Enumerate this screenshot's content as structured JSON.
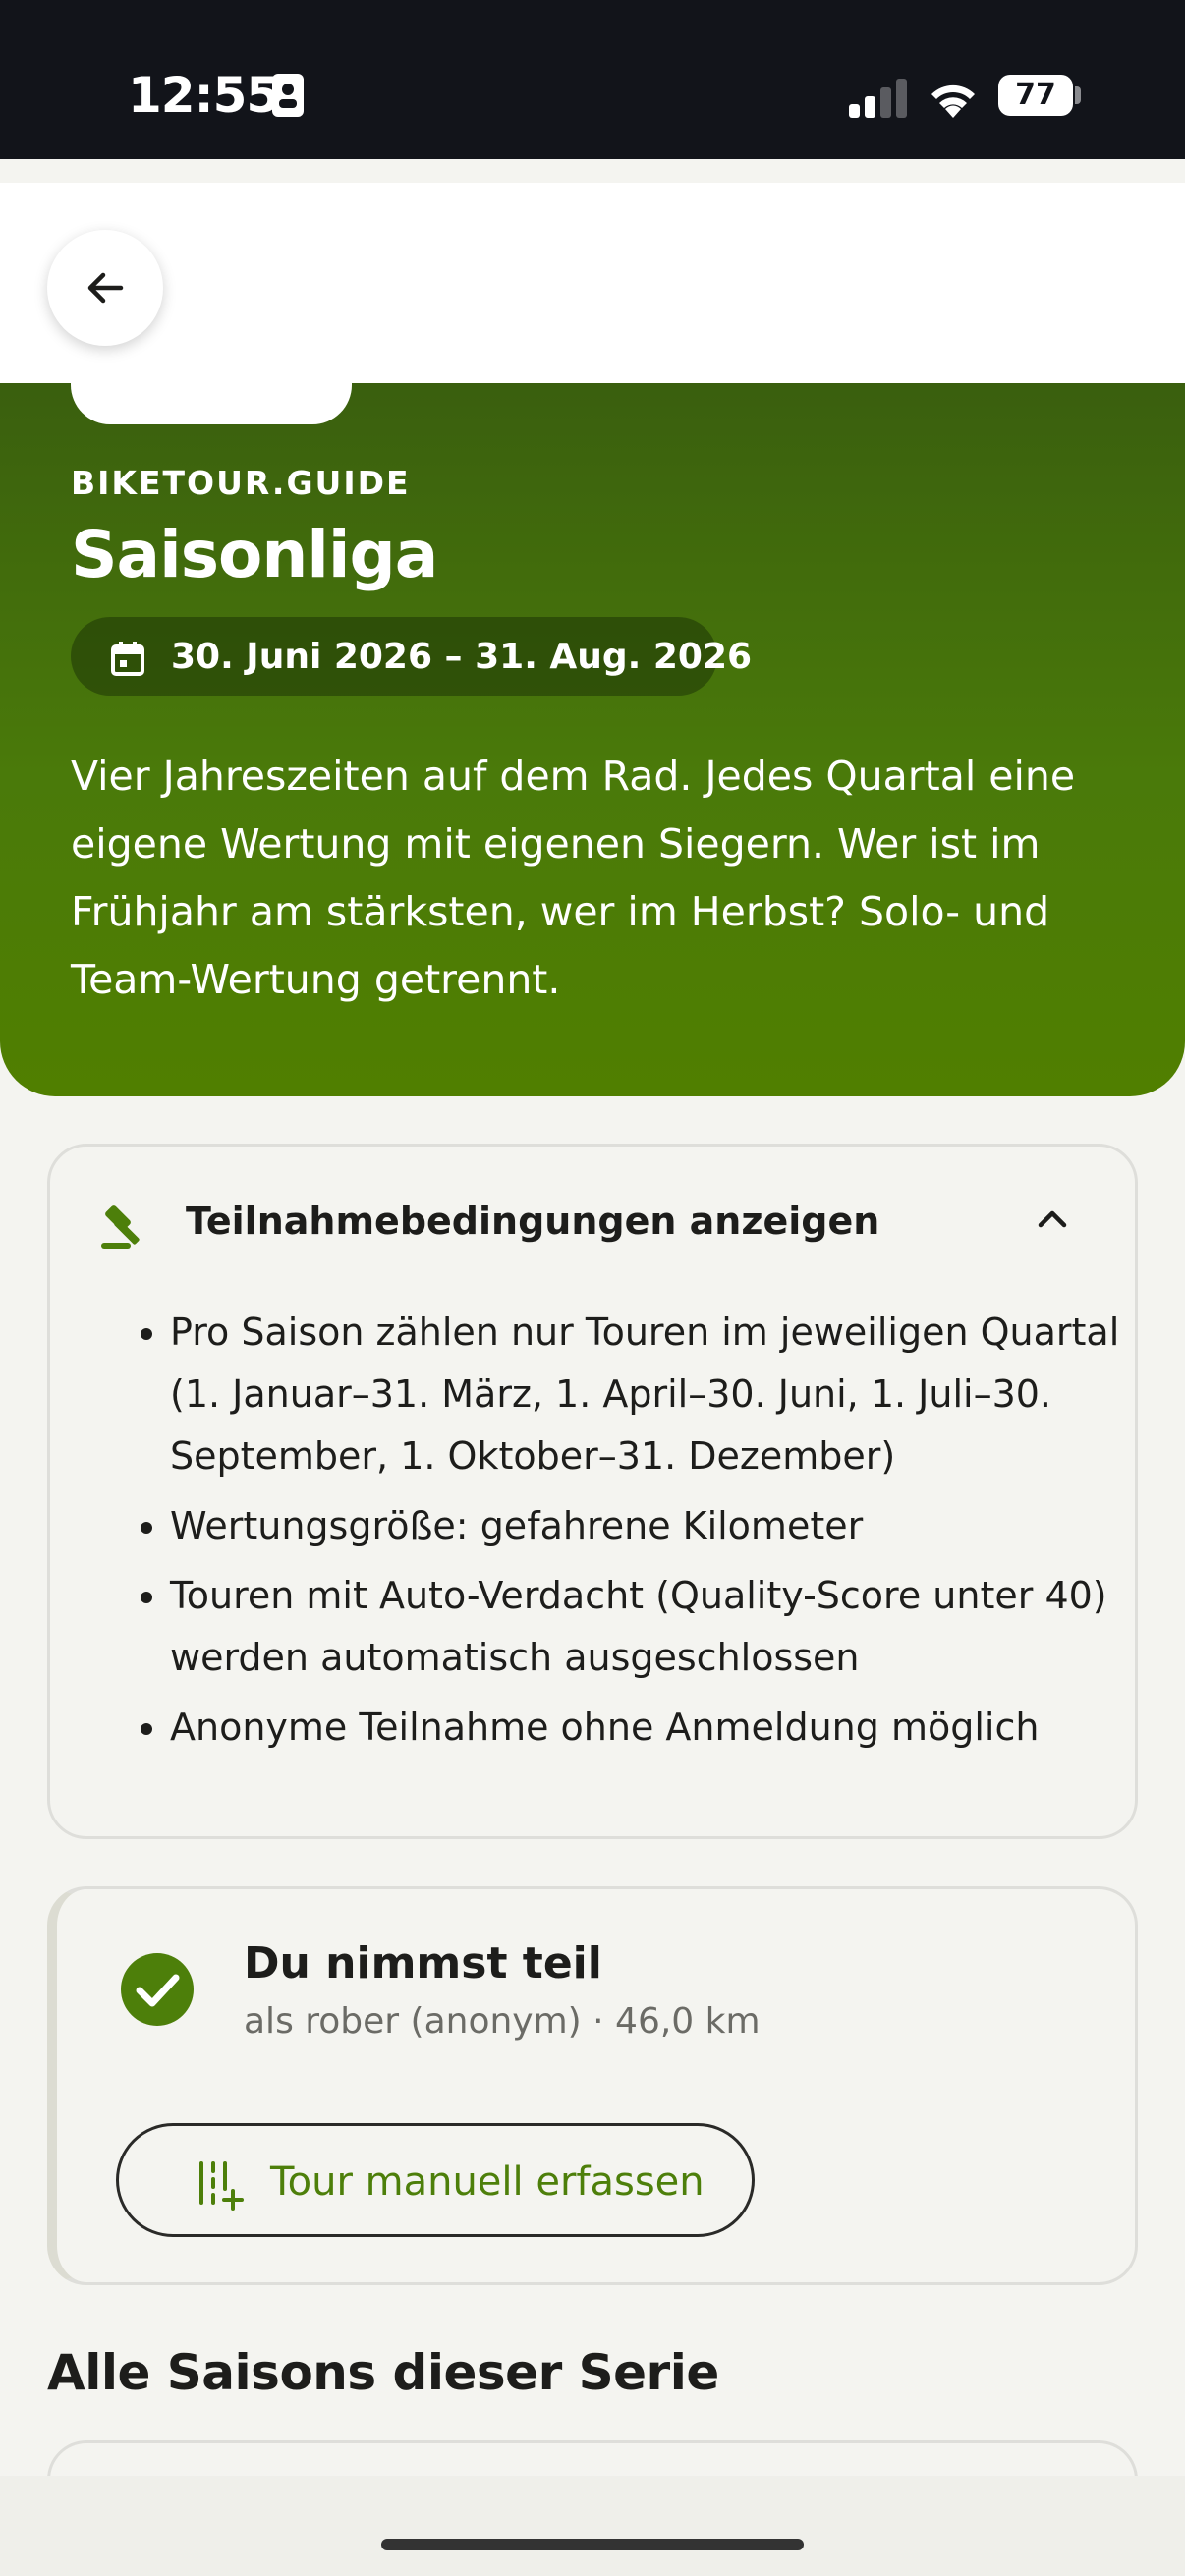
{
  "status_bar": {
    "time": "12:55",
    "battery": "77"
  },
  "header": {
    "back_icon": "arrow-left-icon"
  },
  "hero": {
    "eyebrow": "BIKETOUR.GUIDE",
    "title": "Saisonliga",
    "date_range": "30. Juni 2026 – 31. Aug. 2026",
    "description": "Vier Jahreszeiten auf dem Rad. Jedes Quartal eine eigene Wertung mit eigenen Siegern. Wer ist im Frühjahr am stärksten, wer im Herbst? Solo- und Team-Wertung getrennt.",
    "colors": {
      "start": "#3a5f0e",
      "end": "#507f00"
    }
  },
  "conditions": {
    "title": "Teilnahmebedingungen anzeigen",
    "expanded": true,
    "items": [
      "Pro Saison zählen nur Touren im jeweiligen Quartal (1. Januar–31. März, 1. April–30. Juni, 1. Juli–30. September, 1. Oktober–31. Dezember)",
      "Wertungsgröße: gefahrene Kilometer",
      "Touren mit Auto-Verdacht (Quality-Score unter 40) werden automatisch ausgeschlossen",
      "Anonyme Teilnahme ohne Anmeldung möglich"
    ]
  },
  "participation": {
    "title": "Du nimmst teil",
    "subtitle": "als rober (anonym) · 46,0 km",
    "button_label": "Tour manuell erfassen",
    "accent": "#4d7f0a"
  },
  "seasons": {
    "title": "Alle Saisons dieser Serie"
  }
}
